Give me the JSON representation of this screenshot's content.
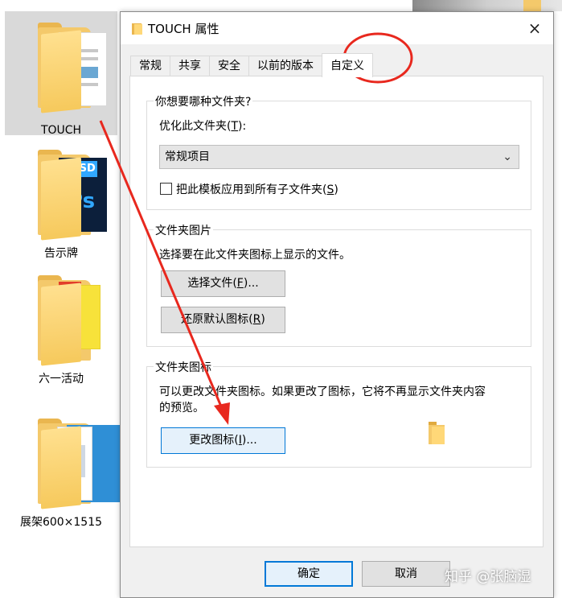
{
  "desktop": {
    "items": [
      {
        "label": "TOUCH",
        "icon": "folder-icon"
      },
      {
        "label": "告示牌",
        "icon": "folder-psd-icon"
      },
      {
        "label": "六一活动",
        "icon": "folder-images-icon"
      },
      {
        "label": "展架600×1515",
        "icon": "folder-ps-icon"
      }
    ],
    "psd_badge": "PSD",
    "ps_glyph": "Ps"
  },
  "dialog": {
    "title": "TOUCH 属性",
    "close_label": "×",
    "tabs": [
      {
        "label": "常规"
      },
      {
        "label": "共享"
      },
      {
        "label": "安全"
      },
      {
        "label": "以前的版本"
      },
      {
        "label": "自定义"
      }
    ],
    "group_type": {
      "title": "你想要哪种文件夹?",
      "optimize_label": "优化此文件夹(",
      "optimize_key": "T",
      "optimize_suffix": "):",
      "select_value": "常规项目",
      "checkbox_label": "把此模板应用到所有子文件夹(",
      "checkbox_key": "S",
      "checkbox_suffix": ")",
      "checkbox_checked": false
    },
    "group_picture": {
      "title": "文件夹图片",
      "desc": "选择要在此文件夹图标上显示的文件。",
      "choose_label": "选择文件(",
      "choose_key": "F",
      "choose_suffix": ")...",
      "restore_label": "还原默认图标(",
      "restore_key": "R",
      "restore_suffix": ")"
    },
    "group_icon": {
      "title": "文件夹图标",
      "desc_line1": "可以更改文件夹图标。如果更改了图标，它将不再显示文件夹内容",
      "desc_line2": "的预览。",
      "change_label": "更改图标(",
      "change_key": "I",
      "change_suffix": ")..."
    },
    "footer": {
      "ok_label": "确定",
      "cancel_label": "取消"
    }
  },
  "watermark": "知乎 @张脑湿",
  "colors": {
    "annotation_red": "#e8281e",
    "accent_blue": "#0078d7",
    "folder_yellow": "#f4c96b"
  }
}
